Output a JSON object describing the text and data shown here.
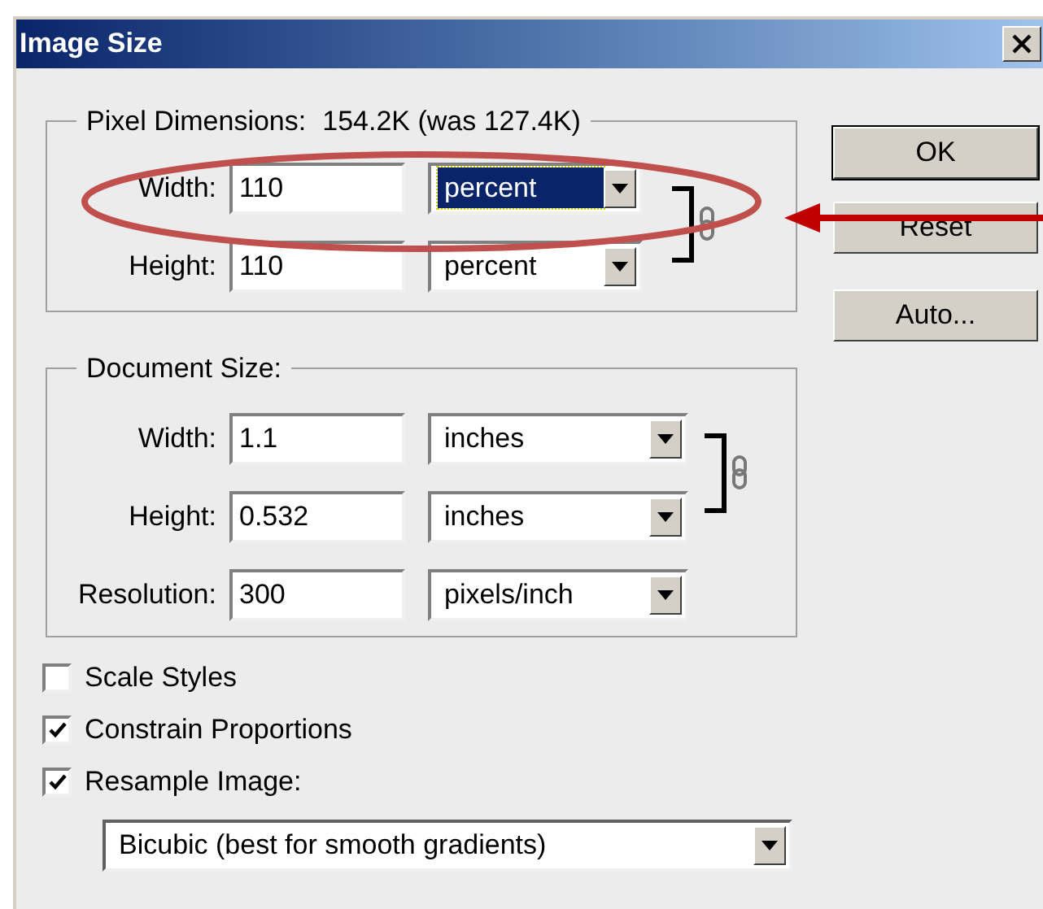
{
  "window": {
    "title": "Image Size"
  },
  "pixel_dimensions": {
    "legend": "Pixel Dimensions:",
    "value": "154.2K (was 127.4K)",
    "fields": [
      {
        "label": "Width:",
        "value": "110",
        "unit": "percent",
        "selected": true
      },
      {
        "label": "Height:",
        "value": "110",
        "unit": "percent",
        "selected": false
      }
    ]
  },
  "document_size": {
    "legend": "Document Size:",
    "fields": [
      {
        "label": "Width:",
        "value": "1.1",
        "unit": "inches",
        "selected": false
      },
      {
        "label": "Height:",
        "value": "0.532",
        "unit": "inches",
        "selected": false
      },
      {
        "label": "Resolution:",
        "value": "300",
        "unit": "pixels/inch",
        "selected": false
      }
    ]
  },
  "buttons": [
    "OK",
    "Reset",
    "Auto..."
  ],
  "checkboxes": [
    {
      "label": "Scale Styles",
      "checked": false
    },
    {
      "label": "Constrain Proportions",
      "checked": true
    },
    {
      "label": "Resample Image:",
      "checked": true
    }
  ],
  "resample_method": "Bicubic (best for smooth gradients)"
}
